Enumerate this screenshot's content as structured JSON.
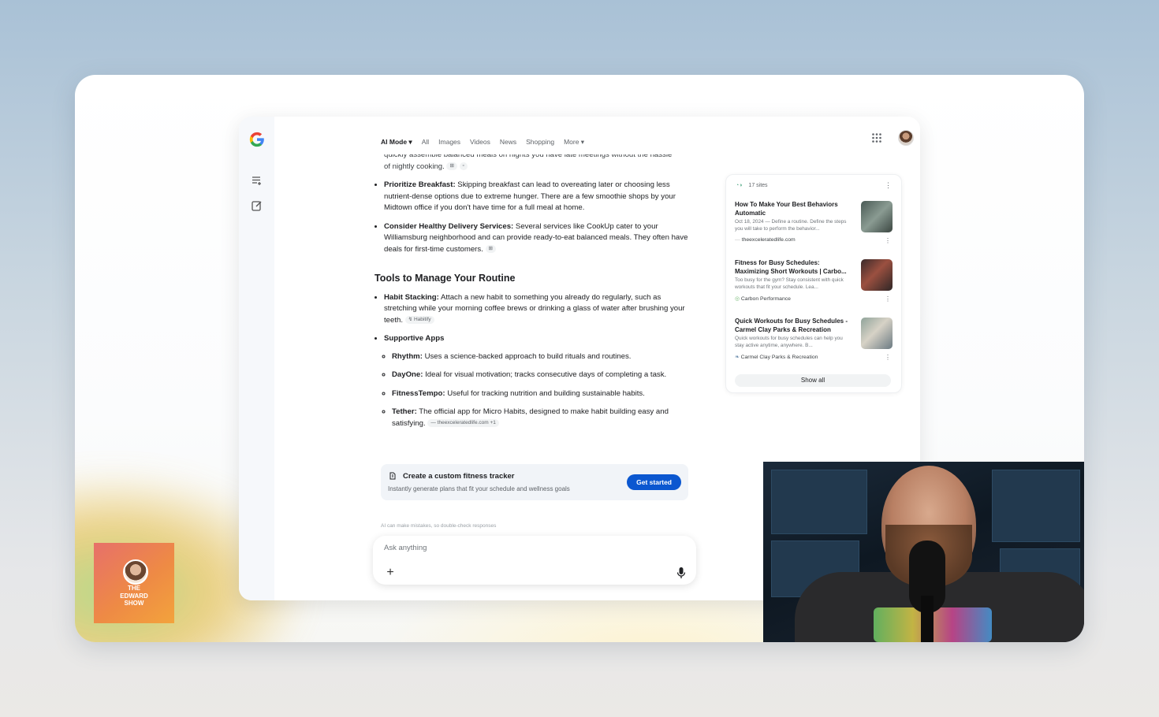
{
  "nav": {
    "tabs": [
      {
        "label": "AI Mode"
      },
      {
        "label": "All"
      },
      {
        "label": "Images"
      },
      {
        "label": "Videos"
      },
      {
        "label": "News"
      },
      {
        "label": "Shopping"
      },
      {
        "label": "More"
      }
    ]
  },
  "content": {
    "intro_line1": "quickly assemble balanced meals on nights you have late meetings without the hassle",
    "intro_line2": "of nightly cooking.",
    "bullets": [
      {
        "bold": "Prioritize Breakfast:",
        "text": " Skipping breakfast can lead to overeating later or choosing less nutrient-dense options due to extreme hunger. There are a few smoothie shops by your Midtown office if you don't have time for a full meal at home."
      },
      {
        "bold": "Consider Healthy Delivery Services:",
        "text": " Several services like CookUp cater to your Williamsburg neighborhood and can provide ready-to-eat balanced meals. They often have deals for first-time customers."
      }
    ],
    "section_title": "Tools to Manage Your Routine",
    "habit": {
      "bold": "Habit Stacking:",
      "text": " Attach a new habit to something you already do regularly, such as stretching while your morning coffee brews or drinking a glass of water after brushing your teeth.",
      "chip": "Habitify"
    },
    "apps_heading": "Supportive Apps",
    "apps": [
      {
        "bold": "Rhythm:",
        "text": " Uses a science-backed approach to build rituals and routines."
      },
      {
        "bold": "DayOne:",
        "text": " Ideal for visual motivation; tracks consecutive days of completing a task."
      },
      {
        "bold": "FitnessTempo:",
        "text": " Useful for tracking nutrition and building sustainable habits."
      },
      {
        "bold": "Tether:",
        "text": " The official app for Micro Habits, designed to make habit building easy and satisfying.",
        "chip": "theexceleratedlife.com +1"
      }
    ]
  },
  "tracker": {
    "title": "Create a custom fitness tracker",
    "subtitle": "Instantly generate plans that fit your schedule and wellness goals",
    "button": "Get started"
  },
  "disclaimer": "AI can make mistakes, so double-check responses",
  "ask": {
    "placeholder": "Ask anything"
  },
  "sources": {
    "count_label": "17 sites",
    "items": [
      {
        "title": "How To Make Your Best Behaviors Automatic",
        "desc": "Oct 18, 2024 — Define a routine. Define the steps you will take to perform the behavior...",
        "site": "theexceleratedlife.com"
      },
      {
        "title": "Fitness for Busy Schedules: Maximizing Short Workouts | Carbo...",
        "desc": "Too busy for the gym? Stay consistent with quick workouts that fit your schedule. Lea...",
        "site": "Carbon Performance"
      },
      {
        "title": "Quick Workouts for Busy Schedules - Carmel Clay Parks & Recreation",
        "desc": "Quick workouts for busy schedules can help you stay active anytime, anywhere. B...",
        "site": "Carmel Clay Parks & Recreation"
      }
    ],
    "show_all": "Show all"
  },
  "badge": {
    "text": "THE\nEDWARD\nSHOW"
  },
  "colors": {
    "accent": "#0b57d0",
    "badge": "#ee8a45"
  }
}
